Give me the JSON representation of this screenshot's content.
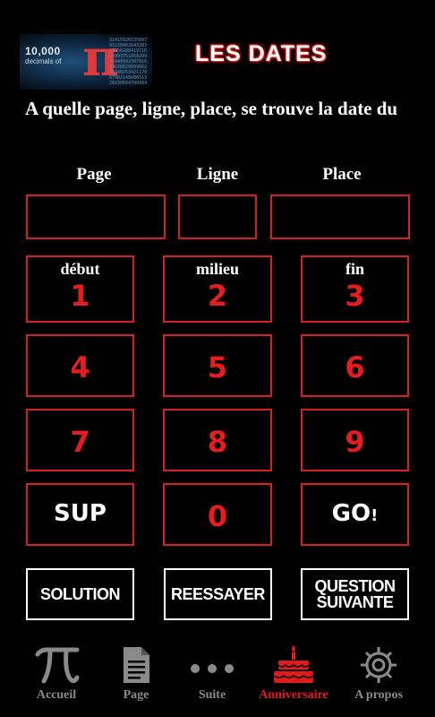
{
  "header": {
    "logo_number": "10,000",
    "logo_caption": "decimals of",
    "logo_pi": "π",
    "title": "LES DATES"
  },
  "question": "A quelle page, ligne, place, se trouve la date du",
  "fields": {
    "page_label": "Page",
    "line_label": "Ligne",
    "place_label": "Place",
    "page_value": "",
    "line_value": "",
    "place_value": ""
  },
  "keypad": {
    "k1_sub": "début",
    "k1": "1",
    "k2_sub": "milieu",
    "k2": "2",
    "k3_sub": "fin",
    "k3": "3",
    "k4": "4",
    "k5": "5",
    "k6": "6",
    "k7": "7",
    "k8": "8",
    "k9": "9",
    "sup": "SUP",
    "k0": "0",
    "go": "GO",
    "go_suffix": "!"
  },
  "actions": {
    "solution": "SOLUTION",
    "retry": "REESSAYER",
    "next_line1": "QUESTION",
    "next_line2": "SUIVANTE"
  },
  "tabs": [
    {
      "label": "Accueil",
      "icon": "pi-icon"
    },
    {
      "label": "Page",
      "icon": "document-icon"
    },
    {
      "label": "Suite",
      "icon": "more-dots-icon"
    },
    {
      "label": "Anniversaire",
      "icon": "birthday-cake-icon",
      "active": true
    },
    {
      "label": "A propos",
      "icon": "gear-icon"
    }
  ],
  "colors": {
    "accent": "#d81f1f",
    "digit": "#e81c1c",
    "background": "#000000",
    "tab_inactive": "#8a8a8a",
    "tab_active": "#e01b1b"
  }
}
